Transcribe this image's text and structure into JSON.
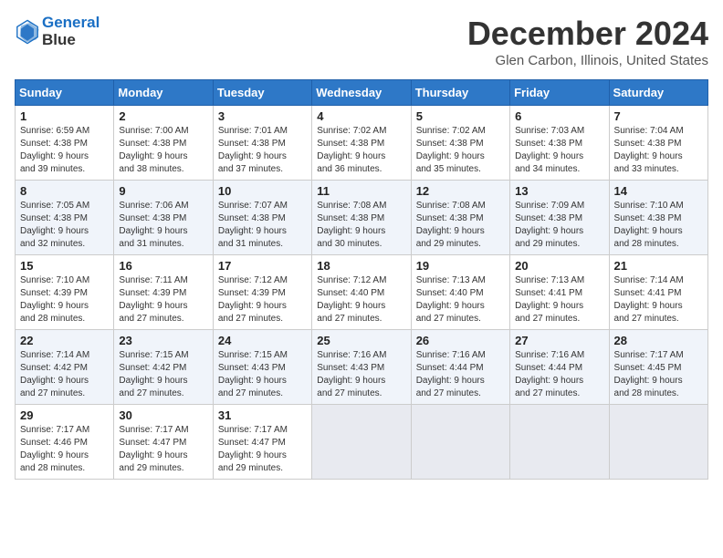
{
  "header": {
    "logo_line1": "General",
    "logo_line2": "Blue",
    "month": "December 2024",
    "location": "Glen Carbon, Illinois, United States"
  },
  "days_of_week": [
    "Sunday",
    "Monday",
    "Tuesday",
    "Wednesday",
    "Thursday",
    "Friday",
    "Saturday"
  ],
  "weeks": [
    [
      {
        "day": "1",
        "info": "Sunrise: 6:59 AM\nSunset: 4:38 PM\nDaylight: 9 hours\nand 39 minutes."
      },
      {
        "day": "2",
        "info": "Sunrise: 7:00 AM\nSunset: 4:38 PM\nDaylight: 9 hours\nand 38 minutes."
      },
      {
        "day": "3",
        "info": "Sunrise: 7:01 AM\nSunset: 4:38 PM\nDaylight: 9 hours\nand 37 minutes."
      },
      {
        "day": "4",
        "info": "Sunrise: 7:02 AM\nSunset: 4:38 PM\nDaylight: 9 hours\nand 36 minutes."
      },
      {
        "day": "5",
        "info": "Sunrise: 7:02 AM\nSunset: 4:38 PM\nDaylight: 9 hours\nand 35 minutes."
      },
      {
        "day": "6",
        "info": "Sunrise: 7:03 AM\nSunset: 4:38 PM\nDaylight: 9 hours\nand 34 minutes."
      },
      {
        "day": "7",
        "info": "Sunrise: 7:04 AM\nSunset: 4:38 PM\nDaylight: 9 hours\nand 33 minutes."
      }
    ],
    [
      {
        "day": "8",
        "info": "Sunrise: 7:05 AM\nSunset: 4:38 PM\nDaylight: 9 hours\nand 32 minutes."
      },
      {
        "day": "9",
        "info": "Sunrise: 7:06 AM\nSunset: 4:38 PM\nDaylight: 9 hours\nand 31 minutes."
      },
      {
        "day": "10",
        "info": "Sunrise: 7:07 AM\nSunset: 4:38 PM\nDaylight: 9 hours\nand 31 minutes."
      },
      {
        "day": "11",
        "info": "Sunrise: 7:08 AM\nSunset: 4:38 PM\nDaylight: 9 hours\nand 30 minutes."
      },
      {
        "day": "12",
        "info": "Sunrise: 7:08 AM\nSunset: 4:38 PM\nDaylight: 9 hours\nand 29 minutes."
      },
      {
        "day": "13",
        "info": "Sunrise: 7:09 AM\nSunset: 4:38 PM\nDaylight: 9 hours\nand 29 minutes."
      },
      {
        "day": "14",
        "info": "Sunrise: 7:10 AM\nSunset: 4:38 PM\nDaylight: 9 hours\nand 28 minutes."
      }
    ],
    [
      {
        "day": "15",
        "info": "Sunrise: 7:10 AM\nSunset: 4:39 PM\nDaylight: 9 hours\nand 28 minutes."
      },
      {
        "day": "16",
        "info": "Sunrise: 7:11 AM\nSunset: 4:39 PM\nDaylight: 9 hours\nand 27 minutes."
      },
      {
        "day": "17",
        "info": "Sunrise: 7:12 AM\nSunset: 4:39 PM\nDaylight: 9 hours\nand 27 minutes."
      },
      {
        "day": "18",
        "info": "Sunrise: 7:12 AM\nSunset: 4:40 PM\nDaylight: 9 hours\nand 27 minutes."
      },
      {
        "day": "19",
        "info": "Sunrise: 7:13 AM\nSunset: 4:40 PM\nDaylight: 9 hours\nand 27 minutes."
      },
      {
        "day": "20",
        "info": "Sunrise: 7:13 AM\nSunset: 4:41 PM\nDaylight: 9 hours\nand 27 minutes."
      },
      {
        "day": "21",
        "info": "Sunrise: 7:14 AM\nSunset: 4:41 PM\nDaylight: 9 hours\nand 27 minutes."
      }
    ],
    [
      {
        "day": "22",
        "info": "Sunrise: 7:14 AM\nSunset: 4:42 PM\nDaylight: 9 hours\nand 27 minutes."
      },
      {
        "day": "23",
        "info": "Sunrise: 7:15 AM\nSunset: 4:42 PM\nDaylight: 9 hours\nand 27 minutes."
      },
      {
        "day": "24",
        "info": "Sunrise: 7:15 AM\nSunset: 4:43 PM\nDaylight: 9 hours\nand 27 minutes."
      },
      {
        "day": "25",
        "info": "Sunrise: 7:16 AM\nSunset: 4:43 PM\nDaylight: 9 hours\nand 27 minutes."
      },
      {
        "day": "26",
        "info": "Sunrise: 7:16 AM\nSunset: 4:44 PM\nDaylight: 9 hours\nand 27 minutes."
      },
      {
        "day": "27",
        "info": "Sunrise: 7:16 AM\nSunset: 4:44 PM\nDaylight: 9 hours\nand 27 minutes."
      },
      {
        "day": "28",
        "info": "Sunrise: 7:17 AM\nSunset: 4:45 PM\nDaylight: 9 hours\nand 28 minutes."
      }
    ],
    [
      {
        "day": "29",
        "info": "Sunrise: 7:17 AM\nSunset: 4:46 PM\nDaylight: 9 hours\nand 28 minutes."
      },
      {
        "day": "30",
        "info": "Sunrise: 7:17 AM\nSunset: 4:47 PM\nDaylight: 9 hours\nand 29 minutes."
      },
      {
        "day": "31",
        "info": "Sunrise: 7:17 AM\nSunset: 4:47 PM\nDaylight: 9 hours\nand 29 minutes."
      },
      {
        "day": "",
        "info": ""
      },
      {
        "day": "",
        "info": ""
      },
      {
        "day": "",
        "info": ""
      },
      {
        "day": "",
        "info": ""
      }
    ]
  ]
}
